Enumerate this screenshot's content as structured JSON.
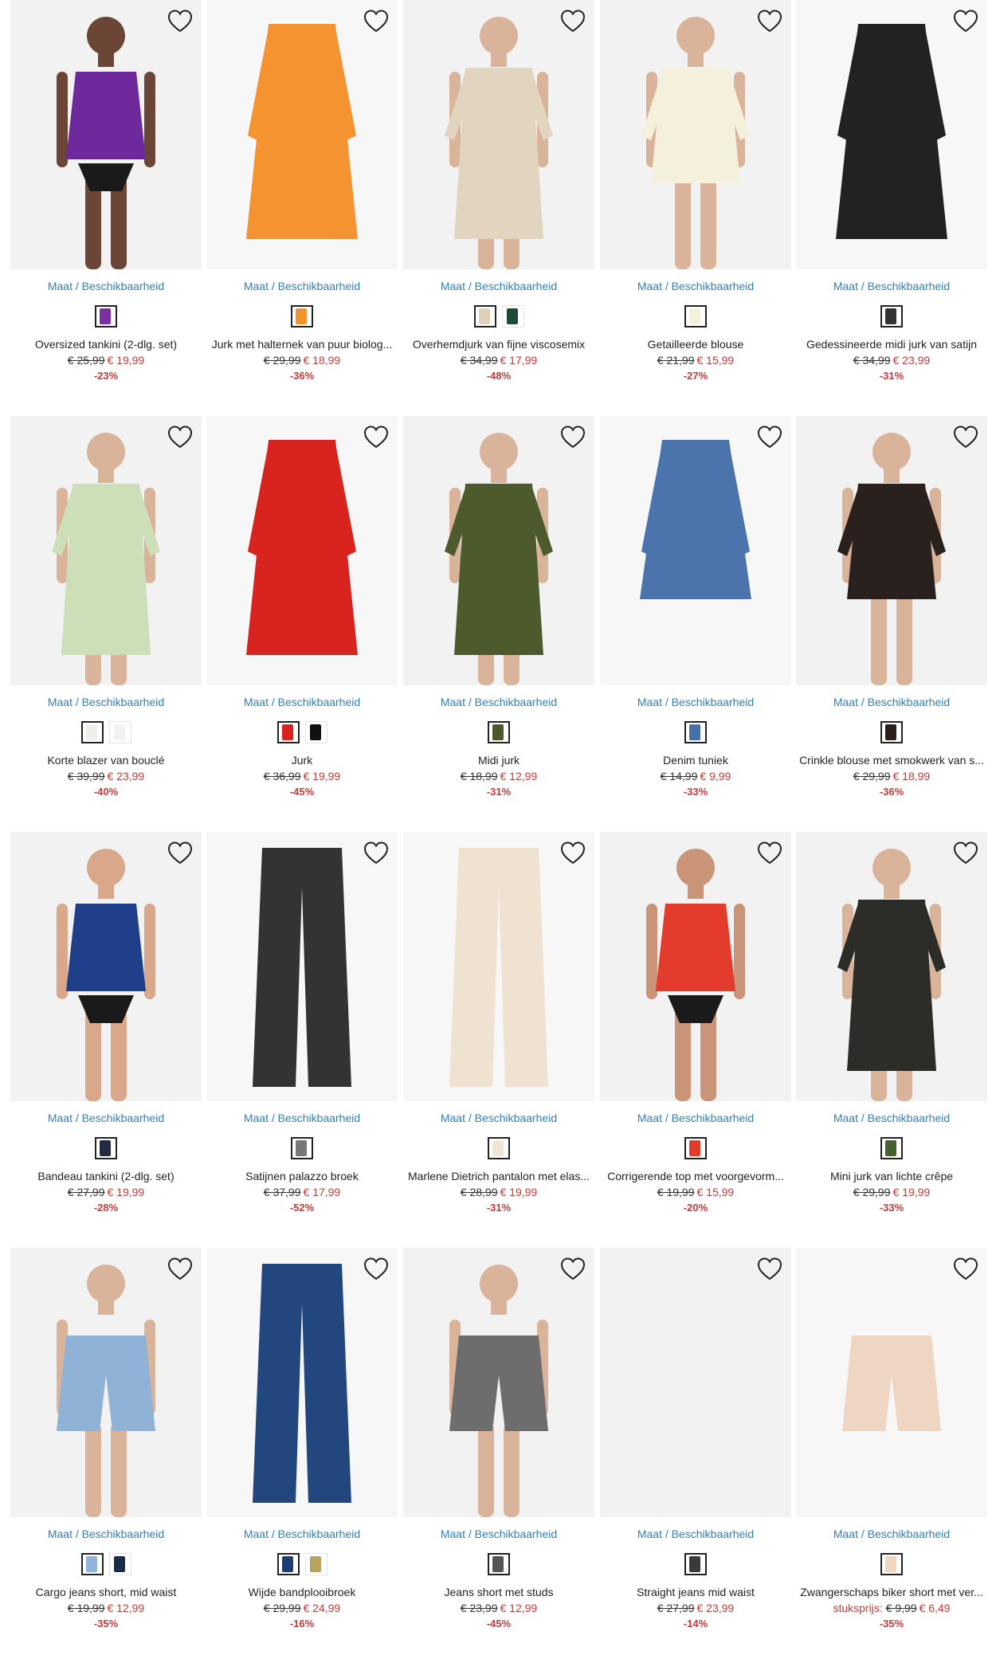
{
  "size_link_label": "Maat / Beschikbaarheid",
  "favorite_icon": "heart-icon",
  "products": [
    {
      "name": "Oversized tankini (2-dlg. set)",
      "old_price": "€ 25,99",
      "price": "€ 19,99",
      "discount": "-23%",
      "swatches": [
        "#7a2fa3"
      ],
      "colors": {
        "bg": "#f2f2f2",
        "garment": "#6e2a9c",
        "skin": "#6b4636"
      }
    },
    {
      "name": "Jurk met halternek van puur biolog...",
      "old_price": "€ 29,99",
      "price": "€ 18,99",
      "discount": "-36%",
      "swatches": [
        "#f3922c"
      ],
      "colors": {
        "bg": "#f7f7f7",
        "garment": "#f59331",
        "skin": ""
      }
    },
    {
      "name": "Overhemdjurk van fijne viscosemix",
      "old_price": "€ 34,99",
      "price": "€ 17,99",
      "discount": "-48%",
      "swatches": [
        "#dfd0b8",
        "#1f4a36"
      ],
      "colors": {
        "bg": "#f2f2f2",
        "garment": "#e2d5bf",
        "skin": "#d9b39a"
      }
    },
    {
      "name": "Getailleerde blouse",
      "old_price": "€ 21,99",
      "price": "€ 15,99",
      "discount": "-27%",
      "swatches": [
        "#f3f0dc"
      ],
      "colors": {
        "bg": "#f2f2f2",
        "garment": "#f4f0dc",
        "skin": "#d9b39a"
      }
    },
    {
      "name": "Gedessineerde midi jurk van satijn",
      "old_price": "€ 34,99",
      "price": "€ 23,99",
      "discount": "-31%",
      "swatches": [
        "#333333"
      ],
      "colors": {
        "bg": "#f7f7f7",
        "garment": "#222222",
        "skin": ""
      }
    },
    {
      "name": "Korte blazer van bouclé",
      "old_price": "€ 39,99",
      "price": "€ 23,99",
      "discount": "-40%",
      "swatches": [
        "#eeeeea",
        "#f2f2f2"
      ],
      "colors": {
        "bg": "#f2f2f2",
        "garment": "#cddfb8",
        "skin": "#d9b39a"
      }
    },
    {
      "name": "Jurk",
      "old_price": "€ 36,99",
      "price": "€ 19,99",
      "discount": "-45%",
      "swatches": [
        "#d8231f",
        "#111111"
      ],
      "colors": {
        "bg": "#f7f7f7",
        "garment": "#d8231f",
        "skin": ""
      }
    },
    {
      "name": "Midi jurk",
      "old_price": "€ 18,99",
      "price": "€ 12,99",
      "discount": "-31%",
      "swatches": [
        "#4b5a2b"
      ],
      "colors": {
        "bg": "#f2f2f2",
        "garment": "#4d5b2c",
        "skin": "#d9b39a"
      }
    },
    {
      "name": "Denim tuniek",
      "old_price": "€ 14,99",
      "price": "€ 9,99",
      "discount": "-33%",
      "swatches": [
        "#4670a8"
      ],
      "colors": {
        "bg": "#f7f7f7",
        "garment": "#4a74ab",
        "skin": ""
      }
    },
    {
      "name": "Crinkle blouse met smokwerk van s...",
      "old_price": "€ 29,99",
      "price": "€ 18,99",
      "discount": "-36%",
      "swatches": [
        "#2b1f1c"
      ],
      "colors": {
        "bg": "#f2f2f2",
        "garment": "#2a201d",
        "skin": "#d9b39a"
      }
    },
    {
      "name": "Bandeau tankini (2-dlg. set)",
      "old_price": "€ 27,99",
      "price": "€ 19,99",
      "discount": "-28%",
      "swatches": [
        "#222a44"
      ],
      "colors": {
        "bg": "#f2f2f2",
        "garment": "#1f3f8a",
        "skin": "#d9a88a"
      }
    },
    {
      "name": "Satijnen palazzo broek",
      "old_price": "€ 37,99",
      "price": "€ 17,99",
      "discount": "-52%",
      "swatches": [
        "#777777"
      ],
      "colors": {
        "bg": "#f7f7f7",
        "garment": "#333333",
        "skin": ""
      }
    },
    {
      "name": "Marlene Dietrich pantalon met elas...",
      "old_price": "€ 28,99",
      "price": "€ 19,99",
      "discount": "-31%",
      "swatches": [
        "#f1e6d6"
      ],
      "colors": {
        "bg": "#f7f7f7",
        "garment": "#efe2d0",
        "skin": ""
      }
    },
    {
      "name": "Corrigerende top met voorgevorm...",
      "old_price": "€ 19,99",
      "price": "€ 15,99",
      "discount": "-20%",
      "swatches": [
        "#e23a2b"
      ],
      "colors": {
        "bg": "#f2f2f2",
        "garment": "#e43c2c",
        "skin": "#c99478"
      }
    },
    {
      "name": "Mini jurk van lichte crêpe",
      "old_price": "€ 29,99",
      "price": "€ 19,99",
      "discount": "-33%",
      "swatches": [
        "#46612f"
      ],
      "colors": {
        "bg": "#f2f2f2",
        "garment": "#2c2c28",
        "skin": "#d9b39a"
      }
    },
    {
      "name": "Cargo jeans short, mid waist",
      "old_price": "€ 19,99",
      "price": "€ 12,99",
      "discount": "-35%",
      "swatches": [
        "#8fb3d9",
        "#1b2b4a"
      ],
      "colors": {
        "bg": "#f2f2f2",
        "garment": "#8fb2d6",
        "skin": "#d9b39a"
      }
    },
    {
      "name": "Wijde bandplooibroek",
      "old_price": "€ 29,99",
      "price": "€ 24,99",
      "discount": "-16%",
      "swatches": [
        "#1f3d74",
        "#b7a35c"
      ],
      "colors": {
        "bg": "#f7f7f7",
        "garment": "#22477f",
        "skin": ""
      }
    },
    {
      "name": "Jeans short met studs",
      "old_price": "€ 23,99",
      "price": "€ 12,99",
      "discount": "-45%",
      "swatches": [
        "#555555"
      ],
      "colors": {
        "bg": "#f2f2f2",
        "garment": "#6d6d6d",
        "skin": "#d9b39a"
      }
    },
    {
      "name": "Straight jeans mid waist",
      "old_price": "€ 27,99",
      "price": "€ 23,99",
      "discount": "-14%",
      "swatches": [
        "#3a3a3a"
      ],
      "colors": {
        "bg": "#f2f2f2",
        "garment": "",
        "skin": ""
      }
    },
    {
      "name": "Zwangerschaps biker short met ver...",
      "unit_label": "stuksprijs:",
      "old_price": "€ 9,99",
      "price": "€ 6,49",
      "discount": "-35%",
      "swatches": [
        "#f0d6c1"
      ],
      "colors": {
        "bg": "#f7f7f7",
        "garment": "#efd6c2",
        "skin": ""
      }
    }
  ]
}
